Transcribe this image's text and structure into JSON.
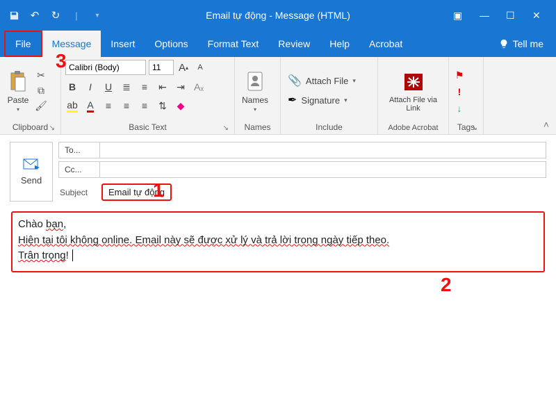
{
  "window": {
    "title": "Email tự động  -  Message (HTML)"
  },
  "tabs": {
    "file": "File",
    "message": "Message",
    "insert": "Insert",
    "options": "Options",
    "formatText": "Format Text",
    "review": "Review",
    "help": "Help",
    "acrobat": "Acrobat",
    "tellMe": "Tell me"
  },
  "ribbon": {
    "clipboard": {
      "paste": "Paste",
      "label": "Clipboard"
    },
    "basicText": {
      "fontName": "Calibri (Body)",
      "fontSize": "11",
      "label": "Basic Text"
    },
    "names": {
      "names": "Names",
      "label": "Names"
    },
    "include": {
      "attachFile": "Attach File",
      "signature": "Signature",
      "label": "Include"
    },
    "adobe": {
      "attach": "Attach File via Link",
      "label": "Adobe Acrobat"
    },
    "tags": {
      "label": "Tags"
    }
  },
  "compose": {
    "send": "Send",
    "to": "To...",
    "cc": "Cc...",
    "subjectLabel": "Subject",
    "subjectValue": "Email tự động"
  },
  "body": {
    "line1a": "Chào ",
    "line1b": "bạn",
    "line1c": ",",
    "line2a": "Hiện tại tôi không online. Email này sẽ được xử lý và trả lời trong ngày tiếp theo.",
    "line3a": "Trân trọng",
    "line3b": "!"
  },
  "annotations": {
    "n1": "1",
    "n2": "2",
    "n3": "3"
  }
}
